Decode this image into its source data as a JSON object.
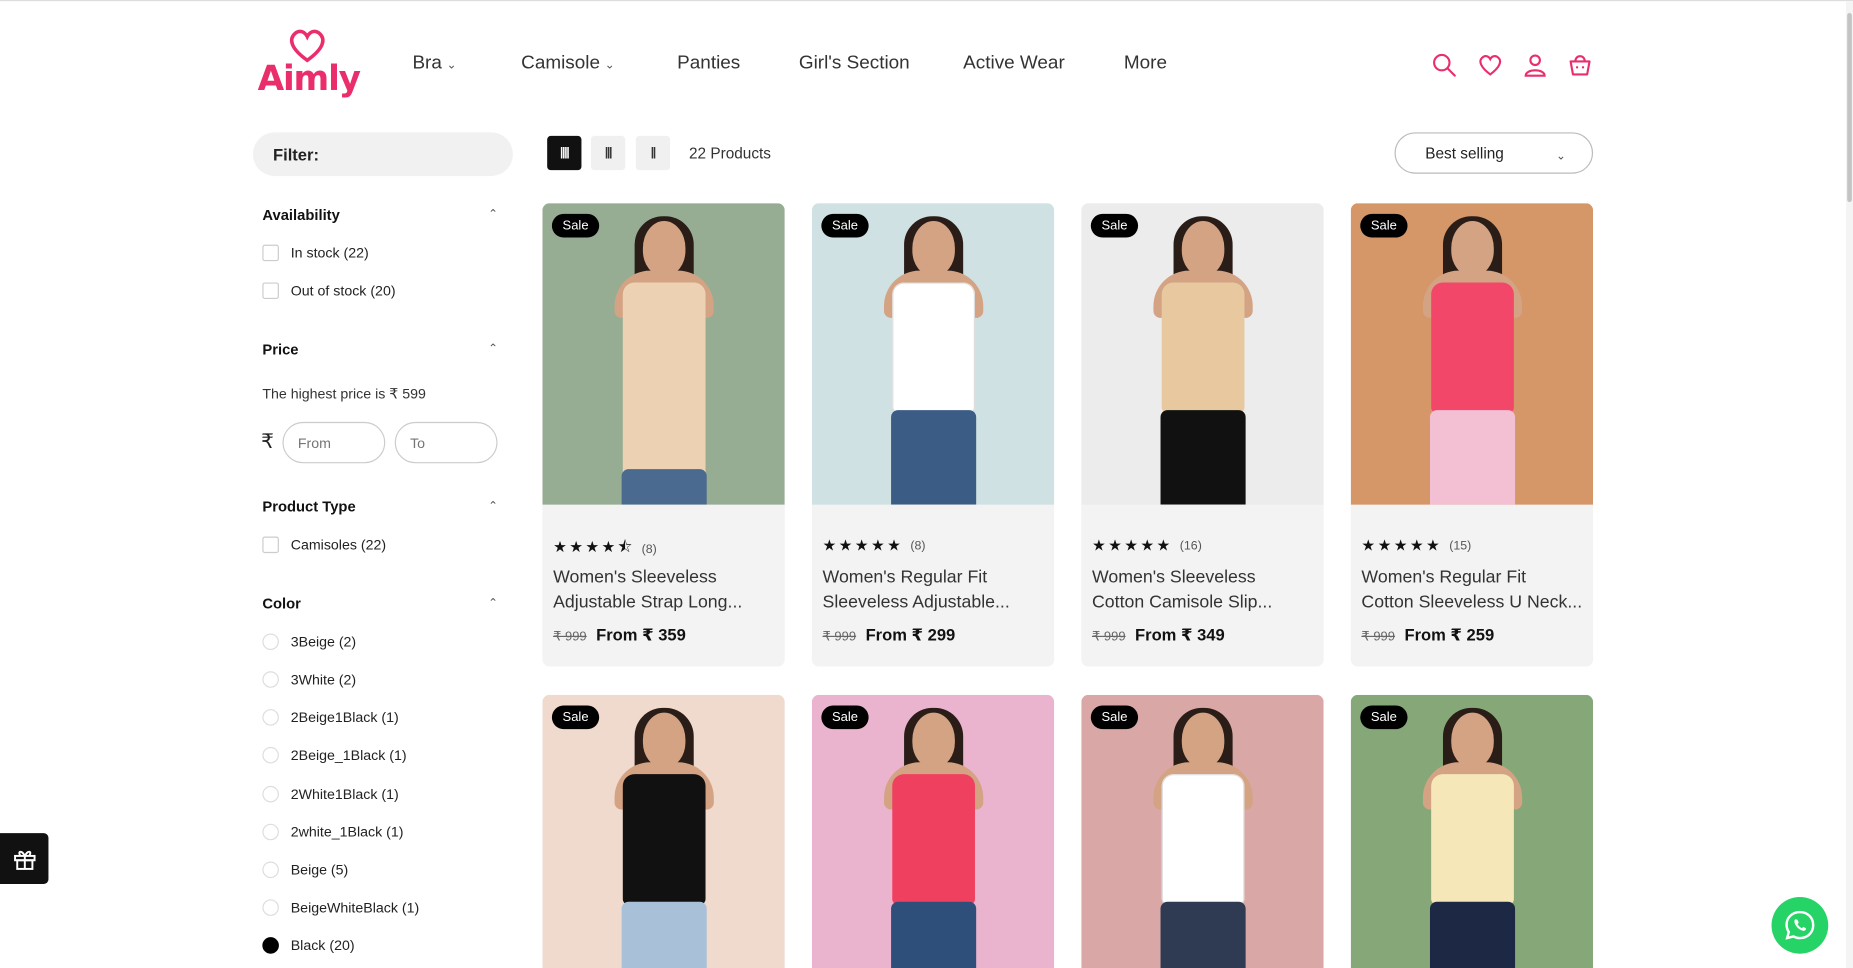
{
  "brand": {
    "name": "Aimly",
    "color": "#ea2e6b"
  },
  "nav": [
    {
      "label": "Bra",
      "has_dropdown": true
    },
    {
      "label": "Camisole",
      "has_dropdown": true
    },
    {
      "label": "Panties",
      "has_dropdown": false
    },
    {
      "label": "Girl's Section",
      "has_dropdown": false
    },
    {
      "label": "Active Wear",
      "has_dropdown": false
    },
    {
      "label": "More",
      "has_dropdown": false
    }
  ],
  "header_icons": [
    "search-icon",
    "wishlist-heart-icon",
    "account-icon",
    "cart-icon"
  ],
  "filter": {
    "title": "Filter:",
    "availability": {
      "title": "Availability",
      "options": [
        "In stock (22)",
        "Out of stock (20)"
      ]
    },
    "price": {
      "title": "Price",
      "note": "The highest price is ₹ 599",
      "currency": "₹",
      "from_placeholder": "From",
      "to_placeholder": "To"
    },
    "product_type": {
      "title": "Product Type",
      "options": [
        "Camisoles (22)"
      ]
    },
    "color": {
      "title": "Color",
      "options": [
        "3Beige (2)",
        "3White (2)",
        "2Beige1Black (1)",
        "2Beige_1Black (1)",
        "2White1Black (1)",
        "2white_1Black (1)",
        "Beige (5)",
        "BeigeWhiteBlack (1)",
        "Black (20)"
      ]
    }
  },
  "toolbar": {
    "views": [
      "||||",
      "|||",
      "||"
    ],
    "product_count": "22 Products",
    "sort_label": "Best selling"
  },
  "products": [
    {
      "badge": "Sale",
      "rating_stars": "★★★★⯪",
      "reviews": "(8)",
      "title_line1": "Women's Sleeveless",
      "title_line2": "Adjustable Strap Long...",
      "compare_price": "₹ 999",
      "price": "From ₹ 359",
      "bg": "#96ad94",
      "garment": "#ecd2b2",
      "bottom": "#4a6a8f"
    },
    {
      "badge": "Sale",
      "rating_stars": "★★★★★",
      "reviews": "(8)",
      "title_line1": "Women's Regular Fit",
      "title_line2": "Sleeveless Adjustable...",
      "compare_price": "₹ 999",
      "price": "From ₹ 299",
      "bg": "#cfe1e2",
      "garment": "#ffffff",
      "bottom": "#3b5c85"
    },
    {
      "badge": "Sale",
      "rating_stars": "★★★★★",
      "reviews": "(16)",
      "title_line1": "Women's Sleeveless",
      "title_line2": "Cotton Camisole Slip...",
      "compare_price": "₹ 999",
      "price": "From ₹ 349",
      "bg": "#ececec",
      "garment": "#e8c99f",
      "bottom": "#111111"
    },
    {
      "badge": "Sale",
      "rating_stars": "★★★★★",
      "reviews": "(15)",
      "title_line1": "Women's Regular Fit",
      "title_line2": "Cotton Sleeveless U Neck...",
      "compare_price": "₹ 999",
      "price": "From ₹ 259",
      "bg": "#d59668",
      "garment": "#f3476a",
      "bottom": "#f2bfd3"
    },
    {
      "badge": "Sale",
      "bg": "#f0d9cd",
      "garment": "#111111",
      "bottom": "#a9c1d8"
    },
    {
      "badge": "Sale",
      "bg": "#eab4cf",
      "garment": "#f0405f",
      "bottom": "#2e4f7a"
    },
    {
      "badge": "Sale",
      "bg": "#d9a8a6",
      "garment": "#ffffff",
      "bottom": "#2f3b52"
    },
    {
      "badge": "Sale",
      "bg": "#86a878",
      "garment": "#f5e7b8",
      "bottom": "#1d2844"
    }
  ]
}
